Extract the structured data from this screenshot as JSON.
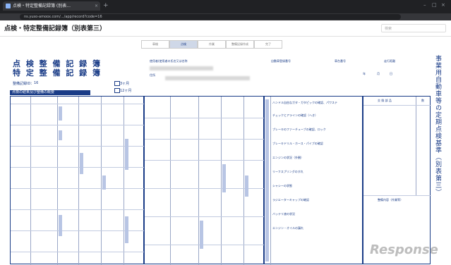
{
  "browser": {
    "tab_title": "点検・特定整備記録簿 (別表...",
    "url": "ns.yuso-amoox.com/.../app/record?code=16"
  },
  "page": {
    "title": "点検・特定整備記録簿（別表第三）",
    "search_placeholder": "検索"
  },
  "steps": [
    {
      "label": "車検"
    },
    {
      "label": "点検",
      "active": true
    },
    {
      "label": "作業"
    },
    {
      "label": "整備記録作成"
    },
    {
      "label": "完了"
    }
  ],
  "form": {
    "title_line1": "点 検 整 備 記 録 簿",
    "title_line2": "特 定 整 備 記 録 簿",
    "record_no_label": "整備記録ID：",
    "record_no": "16",
    "month3": "3ヶ月",
    "month12": "12ヶ月",
    "section_bar": "点検の結果及び整備の概要",
    "owner_label": "使用者(使用者の氏名又は名称",
    "address_label": "住所",
    "reg_no_label": "自動車登録番号",
    "chassis_label": "車台番号",
    "distance_label": "走行距離",
    "year_label": "年",
    "month_label": "月",
    "day_label": "日",
    "vertical_title": "事業用自動車等の定期点検基準（別表第三）",
    "replaced_parts_header": "交 換 部 品",
    "qty_header": "数",
    "maintenance_header": "整備内容（作業等）",
    "checklist": [
      "ハンドル自由なガタ・ガタピックの確認、パワステ",
      "チェックとアラインの確認（へき）",
      "プレーキのファーチューブの確認、ロック",
      "ブレーキドリル・ホース・パイプの確認",
      "エンジンの状況（外観）",
      "リーフスプリングのすれ",
      "シャシーの状態",
      "ラジエーターキャップの確認",
      "バッテリ液の状況",
      "エンジン・オイルの漏れ"
    ]
  }
}
